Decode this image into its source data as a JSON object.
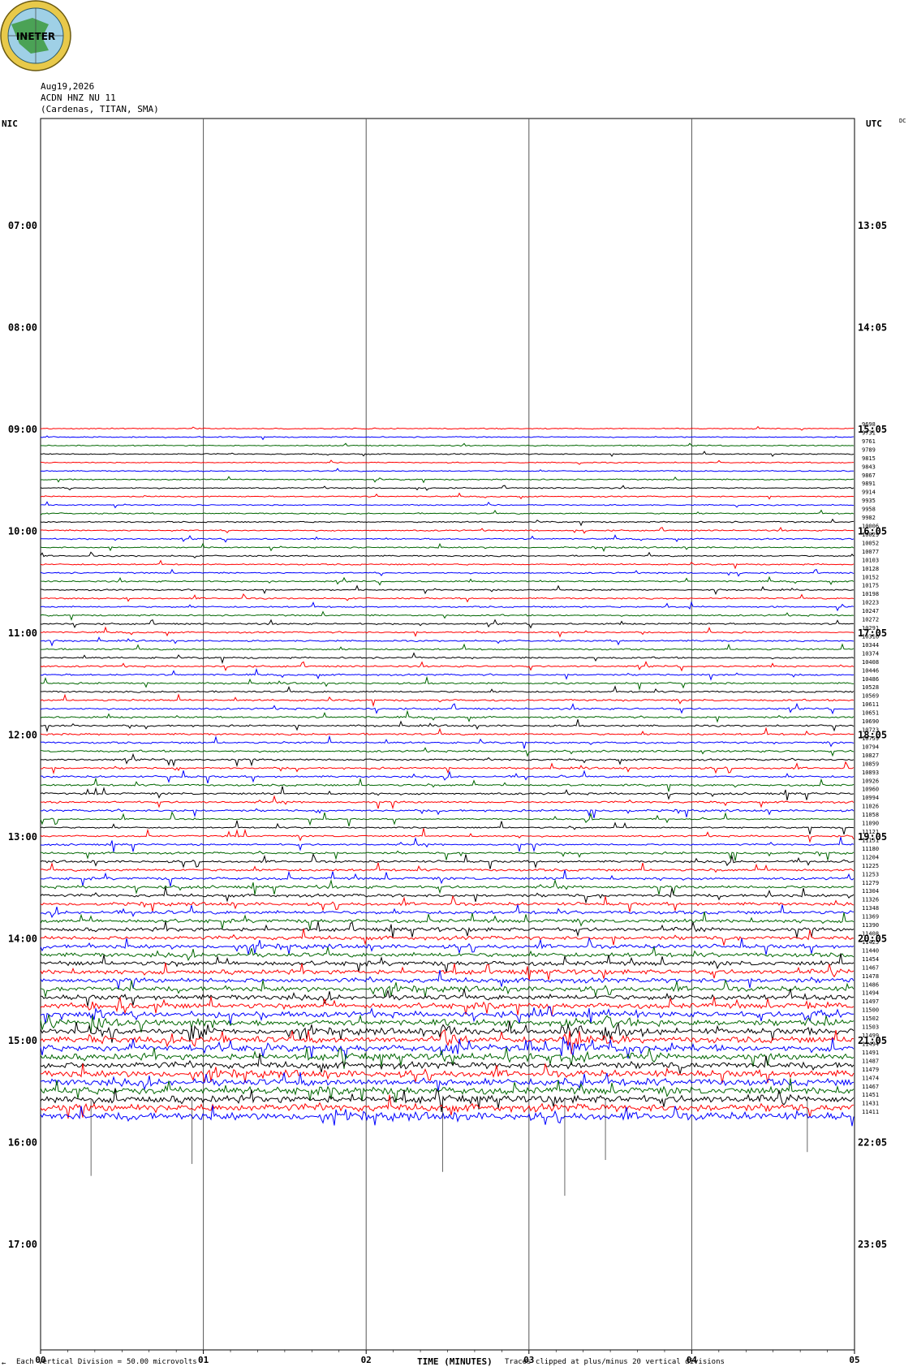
{
  "header": {
    "date": "Aug19,2026",
    "station": "ACDN HNZ NU 11",
    "location": "(Cardenas, TITAN, SMA)",
    "left_tz": "NIC",
    "right_tz": "UTC",
    "dc_tag": "DC",
    "logo_text": "INETER"
  },
  "footer": {
    "scale_mark": "←",
    "scale_note": "Each Vertical Division =",
    "scale_value": "50.00 microvolts",
    "xlabel": "TIME (MINUTES)",
    "clip_note": "Traces clipped at plus/minus 20 vertical divisions"
  },
  "chart_data": {
    "type": "line",
    "title": "",
    "xlabel": "TIME (MINUTES)",
    "xlim": [
      0,
      5
    ],
    "x_ticks": [
      "00",
      "01",
      "02",
      "03",
      "04",
      "05"
    ],
    "left_hour_labels": [
      "07:00",
      "08:00",
      "09:00",
      "10:00",
      "11:00",
      "12:00",
      "13:00",
      "14:00",
      "15:00",
      "16:00",
      "17:00"
    ],
    "right_hour_labels": [
      "13:05",
      "14:05",
      "15:05",
      "16:05",
      "17:05",
      "18:05",
      "19:05",
      "20:05",
      "21:05",
      "22:05",
      "23:05"
    ],
    "trace_start_nic": "09:00",
    "trace_interval_minutes": 5,
    "trace_colors": [
      "#ff0000",
      "#0000ff",
      "#006600",
      "#000000"
    ],
    "trace_color_start": 0,
    "trace_values": [
      9698,
      9731,
      9761,
      9789,
      9815,
      9843,
      9867,
      9891,
      9914,
      9935,
      9958,
      9982,
      10006,
      10029,
      10052,
      10077,
      10103,
      10128,
      10152,
      10175,
      10198,
      10223,
      10247,
      10272,
      10291,
      10316,
      10344,
      10374,
      10408,
      10446,
      10486,
      10528,
      10569,
      10611,
      10651,
      10690,
      10723,
      10759,
      10794,
      10827,
      10859,
      10893,
      10926,
      10960,
      10994,
      11026,
      11058,
      11090,
      11121,
      11151,
      11180,
      11204,
      11225,
      11253,
      11279,
      11304,
      11326,
      11348,
      11369,
      11390,
      11408,
      11425,
      11440,
      11454,
      11467,
      11478,
      11486,
      11494,
      11497,
      11500,
      11502,
      11503,
      11499,
      11494,
      11491,
      11487,
      11479,
      11474,
      11467,
      11451,
      11431,
      11411
    ],
    "events": [
      {
        "minute": 0.31,
        "nic_time": "14:50",
        "amplitude": 15
      },
      {
        "minute": 0.93,
        "nic_time": "14:55",
        "amplitude": 12
      },
      {
        "minute": 2.47,
        "nic_time": "15:00",
        "amplitude": 14
      },
      {
        "minute": 3.22,
        "nic_time": "15:00",
        "amplitude": 20
      },
      {
        "minute": 3.47,
        "nic_time": "14:55",
        "amplitude": 11
      },
      {
        "minute": 4.71,
        "nic_time": "14:45",
        "amplitude": 9
      }
    ]
  }
}
